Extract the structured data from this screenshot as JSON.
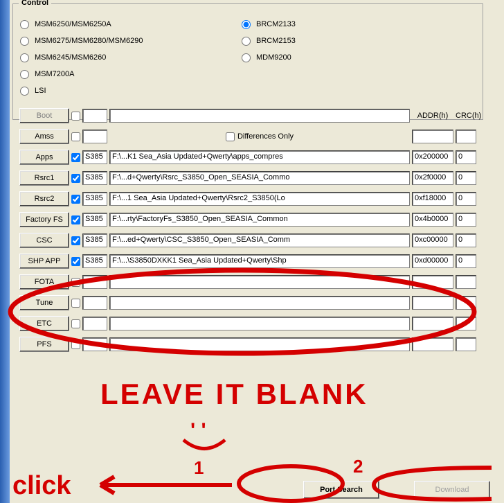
{
  "control": {
    "legend": "Control",
    "left_radios": [
      {
        "label": "MSM6250/MSM6250A",
        "checked": false
      },
      {
        "label": "MSM6275/MSM6280/MSM6290",
        "checked": false
      },
      {
        "label": "MSM6245/MSM6260",
        "checked": false
      },
      {
        "label": "MSM7200A",
        "checked": false
      },
      {
        "label": "LSI",
        "checked": false
      }
    ],
    "right_radios": [
      {
        "label": "BRCM2133",
        "checked": true
      },
      {
        "label": "BRCM2153",
        "checked": false
      },
      {
        "label": "MDM9200",
        "checked": false
      }
    ]
  },
  "headers": {
    "addr": "ADDR(h)",
    "crc": "CRC(h)",
    "differences_only": "Differences Only"
  },
  "rows": [
    {
      "btn": "Boot",
      "disabled": true,
      "checked": false,
      "s385": "",
      "path": "",
      "addr": "",
      "crc": ""
    },
    {
      "btn": "Amss",
      "disabled": false,
      "checked": false,
      "s385": "",
      "path": "",
      "addr": "",
      "crc": ""
    },
    {
      "btn": "Apps",
      "disabled": false,
      "checked": true,
      "s385": "S385",
      "path": "F:\\...K1 Sea_Asia Updated+Qwerty\\apps_compres",
      "addr": "0x200000",
      "crc": "0"
    },
    {
      "btn": "Rsrc1",
      "disabled": false,
      "checked": true,
      "s385": "S385",
      "path": "F:\\...d+Qwerty\\Rsrc_S3850_Open_SEASIA_Commo",
      "addr": "0x2f0000",
      "crc": "0"
    },
    {
      "btn": "Rsrc2",
      "disabled": false,
      "checked": true,
      "s385": "S385",
      "path": "F:\\...1 Sea_Asia Updated+Qwerty\\Rsrc2_S3850(Lo",
      "addr": "0xf18000",
      "crc": "0"
    },
    {
      "btn": "Factory FS",
      "disabled": false,
      "checked": true,
      "s385": "S385",
      "path": "F:\\...rty\\FactoryFs_S3850_Open_SEASIA_Common",
      "addr": "0x4b0000",
      "crc": "0"
    },
    {
      "btn": "CSC",
      "disabled": false,
      "checked": true,
      "s385": "S385",
      "path": "F:\\...ed+Qwerty\\CSC_S3850_Open_SEASIA_Comm",
      "addr": "0xc00000",
      "crc": "0"
    },
    {
      "btn": "SHP APP",
      "disabled": false,
      "checked": true,
      "s385": "S385",
      "path": "F:\\...\\S3850DXKK1 Sea_Asia Updated+Qwerty\\Shp",
      "addr": "0xd00000",
      "crc": "0"
    },
    {
      "btn": "FOTA",
      "disabled": false,
      "checked": false,
      "s385": "",
      "path": "",
      "addr": "",
      "crc": ""
    },
    {
      "btn": "Tune",
      "disabled": false,
      "checked": false,
      "s385": "",
      "path": "",
      "addr": "",
      "crc": ""
    },
    {
      "btn": "ETC",
      "disabled": false,
      "checked": false,
      "s385": "",
      "path": "",
      "addr": "",
      "crc": ""
    },
    {
      "btn": "PFS",
      "disabled": false,
      "checked": false,
      "s385": "",
      "path": "",
      "addr": "",
      "crc": ""
    }
  ],
  "bottom": {
    "port_search": "Port Search",
    "download": "Download"
  },
  "annotations": {
    "leave_blank": "LEAVE IT BLANK",
    "click": "click",
    "smile": "' '",
    "one": "1",
    "two": "2"
  }
}
